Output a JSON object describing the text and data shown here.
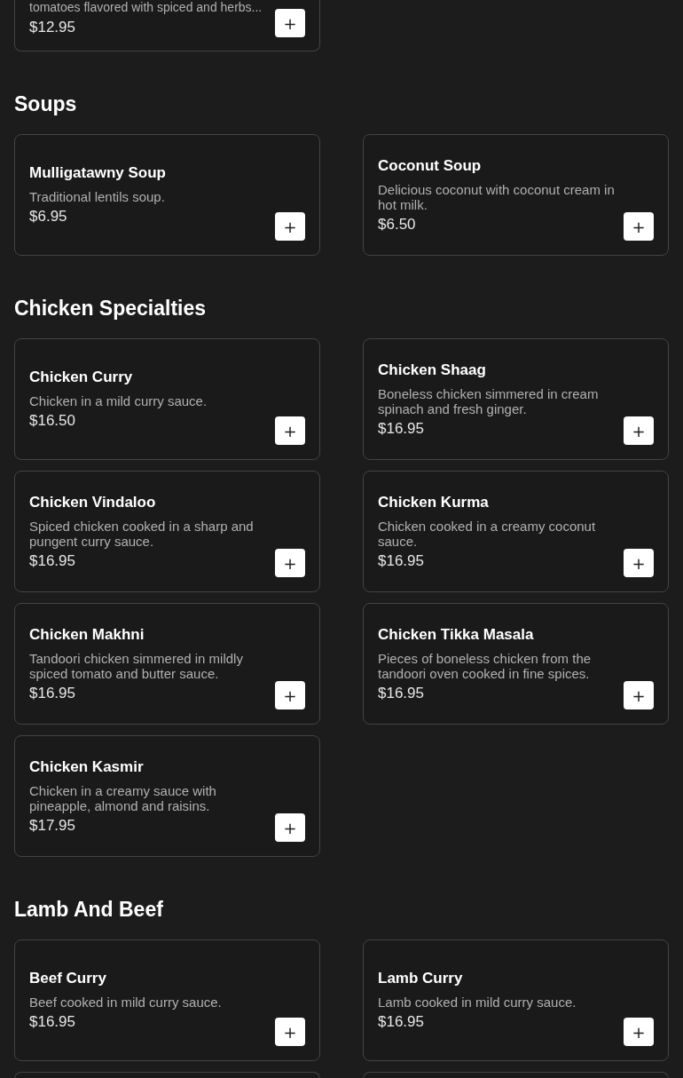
{
  "partial_item": {
    "description": "tomatoes flavored with spiced and herbs...",
    "price": "$12.95",
    "add_button": "+"
  },
  "sections": [
    {
      "title": "Soups",
      "items": [
        {
          "name": "Mulligatawny Soup",
          "description": "Traditional lentils soup.",
          "price": "$6.95",
          "add_button": "+"
        },
        {
          "name": "Coconut Soup",
          "description": "Delicious coconut with coconut cream in hot milk.",
          "price": "$6.50",
          "add_button": "+"
        }
      ]
    },
    {
      "title": "Chicken Specialties",
      "items": [
        {
          "name": "Chicken Curry",
          "description": "Chicken in a mild curry sauce.",
          "price": "$16.50",
          "add_button": "+"
        },
        {
          "name": "Chicken Shaag",
          "description": "Boneless chicken simmered in cream spinach and fresh ginger.",
          "price": "$16.95",
          "add_button": "+"
        },
        {
          "name": "Chicken Vindaloo",
          "description": "Spiced chicken cooked in a sharp and pungent curry sauce.",
          "price": "$16.95",
          "add_button": "+"
        },
        {
          "name": "Chicken Kurma",
          "description": "Chicken cooked in a creamy coconut sauce.",
          "price": "$16.95",
          "add_button": "+"
        },
        {
          "name": "Chicken Makhni",
          "description": "Tandoori chicken simmered in mildly spiced tomato and butter sauce.",
          "price": "$16.95",
          "add_button": "+"
        },
        {
          "name": "Chicken Tikka Masala",
          "description": "Pieces of boneless chicken from the tandoori oven cooked in fine spices.",
          "price": "$16.95",
          "add_button": "+"
        },
        {
          "name": "Chicken Kasmir",
          "description": "Chicken in a creamy sauce with pineapple, almond and raisins.",
          "price": "$17.95",
          "add_button": "+"
        }
      ]
    },
    {
      "title": "Lamb And Beef",
      "items": [
        {
          "name": "Beef Curry",
          "description": "Beef cooked in mild curry sauce.",
          "price": "$16.95",
          "add_button": "+"
        },
        {
          "name": "Lamb Curry",
          "description": "Lamb cooked in mild curry sauce.",
          "price": "$16.95",
          "add_button": "+"
        }
      ]
    }
  ]
}
